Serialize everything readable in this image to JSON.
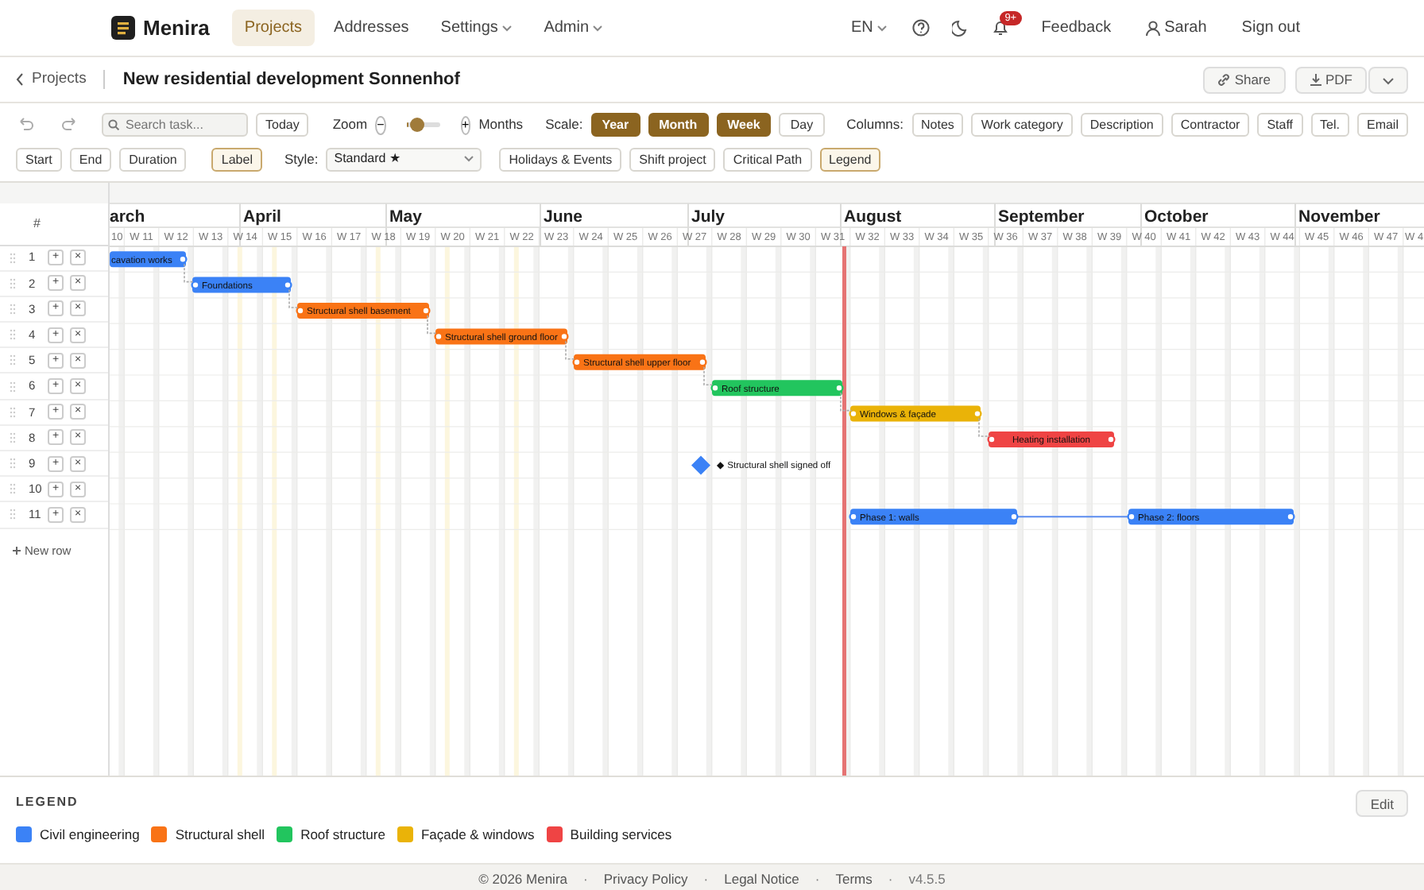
{
  "navbar": {
    "brand": "Menira",
    "items": [
      {
        "label": "Projects",
        "selected": true,
        "dropdown": false
      },
      {
        "label": "Addresses",
        "selected": false,
        "dropdown": false
      },
      {
        "label": "Settings",
        "selected": false,
        "dropdown": true
      },
      {
        "label": "Admin",
        "selected": false,
        "dropdown": true
      }
    ],
    "language": "EN",
    "notifications_badge": "9+",
    "feedback": "Feedback",
    "user": "Sarah",
    "sign_out": "Sign out"
  },
  "header": {
    "back": "Projects",
    "title": "New residential development Sonnenhof",
    "actions": [
      {
        "label": "Share",
        "kind": "share"
      },
      {
        "label": "PDF",
        "kind": "pdf"
      }
    ]
  },
  "toolbar": {
    "search": {
      "placeholder": "Search task..."
    },
    "today": "Today",
    "zoom_label": "Zoom",
    "zoom_minus": "−",
    "zoom": {
      "level": 0.05
    },
    "zoom_plus": "+",
    "zoom_unit": "Months",
    "scale_label": "Scale:",
    "scales": [
      {
        "label": "Year",
        "selected": true
      },
      {
        "label": "Month",
        "selected": true
      },
      {
        "label": "Week",
        "selected": true
      },
      {
        "label": "Day",
        "selected": false
      }
    ],
    "columns_label": "Columns:",
    "columns": [
      {
        "label": "Notes",
        "selected": false
      },
      {
        "label": "Work category",
        "selected": false
      },
      {
        "label": "Description",
        "selected": false
      },
      {
        "label": "Contractor",
        "selected": false
      },
      {
        "label": "Staff",
        "selected": false
      },
      {
        "label": "Tel.",
        "selected": false
      },
      {
        "label": "Email",
        "selected": false
      },
      {
        "label": "Start",
        "selected": false
      },
      {
        "label": "End",
        "selected": false
      },
      {
        "label": "Duration",
        "selected": false
      },
      {
        "label": "Label",
        "selected": true
      }
    ],
    "style_label": "Style:",
    "style_value": "Standard ★",
    "options": [
      {
        "label": "Holidays & Events",
        "selected": false
      },
      {
        "label": "Shift project",
        "selected": false
      },
      {
        "label": "Critical Path",
        "selected": false
      },
      {
        "label": "Legend",
        "selected": true
      }
    ]
  },
  "gantt": {
    "row_header": "#",
    "months": [
      "arch",
      "April",
      "May",
      "June",
      "July",
      "August",
      "September",
      "October",
      "November"
    ],
    "weeks": [
      "10",
      "W 11",
      "W 12",
      "W 13",
      "W 14",
      "W 15",
      "W 16",
      "W 17",
      "W 18",
      "W 19",
      "W 20",
      "W 21",
      "W 22",
      "W 23",
      "W 24",
      "W 25",
      "W 26",
      "W 27",
      "W 28",
      "W 29",
      "W 30",
      "W 31",
      "W 32",
      "W 33",
      "W 34",
      "W 35",
      "W 36",
      "W 37",
      "W 38",
      "W 39",
      "W 40",
      "W 41",
      "W 42",
      "W 43",
      "W 44",
      "W 45",
      "W 46",
      "W 47",
      "W 4"
    ],
    "rows": [
      {
        "number": "1",
        "actions": [
          "+",
          "×"
        ],
        "task": {
          "kind": "bar",
          "label": "cavation works",
          "color": "#3b82f6"
        }
      },
      {
        "number": "2",
        "actions": [
          "+",
          "×"
        ],
        "task": {
          "kind": "bar",
          "label": "Foundations",
          "color": "#3b82f6"
        }
      },
      {
        "number": "3",
        "actions": [
          "+",
          "×"
        ],
        "task": {
          "kind": "bar",
          "label": "Structural shell basement",
          "color": "#f97316"
        }
      },
      {
        "number": "4",
        "actions": [
          "+",
          "×"
        ],
        "task": {
          "kind": "bar",
          "label": "Structural shell ground floor",
          "color": "#f97316"
        }
      },
      {
        "number": "5",
        "actions": [
          "+",
          "×"
        ],
        "task": {
          "kind": "bar",
          "label": "Structural shell upper floor",
          "color": "#f97316"
        }
      },
      {
        "number": "6",
        "actions": [
          "+",
          "×"
        ],
        "task": {
          "kind": "bar",
          "label": "Roof structure",
          "color": "#22c55e"
        }
      },
      {
        "number": "7",
        "actions": [
          "+",
          "×"
        ],
        "task": {
          "kind": "bar",
          "label": "Windows & façade",
          "color": "#eab308"
        }
      },
      {
        "number": "8",
        "actions": [
          "+",
          "×"
        ],
        "task": {
          "kind": "bar",
          "label": "Heating installation",
          "color": "#ef4444"
        }
      },
      {
        "number": "9",
        "actions": [
          "+",
          "×"
        ],
        "task": {
          "kind": "milestone",
          "label": "◆ Structural shell signed off",
          "color": "#3b82f6"
        }
      },
      {
        "number": "10",
        "actions": [
          "+",
          "×"
        ]
      },
      {
        "number": "11",
        "actions": [
          "+",
          "×"
        ],
        "task": {
          "kind": "split",
          "segments": [
            "Phase 1: walls",
            "Phase 2: floors"
          ],
          "color": "#3b82f6"
        }
      }
    ],
    "new_row": "New row"
  },
  "legend": {
    "title": "LEGEND",
    "edit": "Edit",
    "items": [
      {
        "label": "Civil engineering",
        "color": "#3b82f6"
      },
      {
        "label": "Structural shell",
        "color": "#f97316"
      },
      {
        "label": "Roof structure",
        "color": "#22c55e"
      },
      {
        "label": "Façade & windows",
        "color": "#eab308"
      },
      {
        "label": "Building services",
        "color": "#ef4444"
      }
    ]
  },
  "footer": {
    "copyright": "© 2026 Menira",
    "links": [
      "Privacy Policy",
      "Legal Notice",
      "Terms"
    ],
    "separators": [
      "·",
      "·",
      "·",
      "·"
    ],
    "version": "v4.5.5"
  }
}
